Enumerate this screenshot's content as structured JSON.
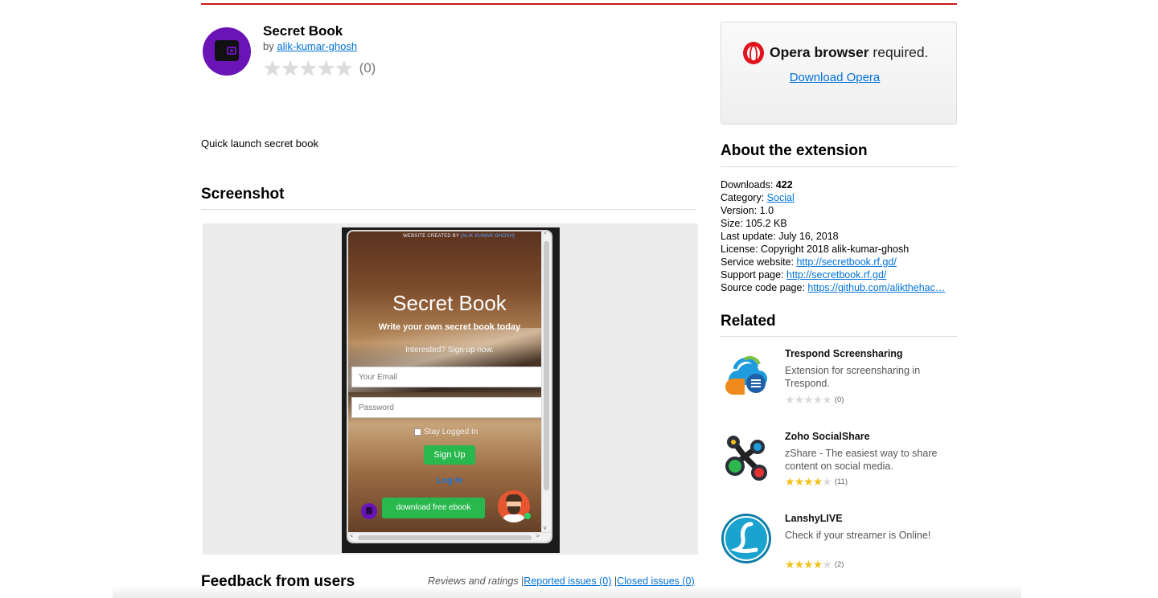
{
  "extension": {
    "title": "Secret Book",
    "by_label": "by",
    "author": "alik-kumar-ghosh",
    "rating_count": "(0)",
    "stars_filled": 0,
    "stars_total": 5,
    "summary": "Quick launch secret book",
    "icon": "wallet-icon"
  },
  "sections": {
    "screenshot": "Screenshot",
    "feedback": "Feedback from users",
    "about": "About the extension",
    "related": "Related"
  },
  "screenshot_popup": {
    "credit_prefix": "WEBSITE CREATED BY ",
    "credit_name": "[ALIK KUMAR GHOSH]",
    "title": "Secret Book",
    "subtitle": "Write your own secret book today",
    "interested": "Interested? Sign up now.",
    "email_placeholder": "Your Email",
    "password_placeholder": "Password",
    "stay_logged": "Stay Logged In",
    "signup": "Sign Up",
    "login": "Log In",
    "download": "download free ebook",
    "scroll_up": "^",
    "scroll_down": "v",
    "scroll_left": "<",
    "scroll_right": ">"
  },
  "feedback_links": {
    "reviews": "Reviews and ratings",
    "separator": "|",
    "reported": "Reported issues (0)",
    "closed": "Closed issues (0)"
  },
  "opera": {
    "brand": "Opera browser",
    "required": "required.",
    "download": "Download Opera",
    "logo": "opera-logo-icon"
  },
  "about": {
    "downloads_label": "Downloads: ",
    "downloads": "422",
    "category_label": "Category: ",
    "category": "Social",
    "version": "Version: 1.0",
    "size": "Size: 105.2 KB",
    "last_update": "Last update: July 16, 2018",
    "license": "License: Copyright 2018 alik-kumar-ghosh",
    "service_label": "Service website: ",
    "service_url": "http://secretbook.rf.gd/",
    "support_label": "Support page: ",
    "support_url": "http://secretbook.rf.gd/",
    "source_label": "Source code page: ",
    "source_url": "https://github.com/alikthehac…"
  },
  "related": [
    {
      "name": "Trespond Screensharing",
      "desc": "Extension for screensharing in Trespond.",
      "rating": 0,
      "count": "(0)",
      "icon": "cloud-screenshare-icon"
    },
    {
      "name": "Zoho SocialShare",
      "desc": "zShare - The easiest way to share content on social media.",
      "rating": 4,
      "count": "(11)",
      "icon": "share-nodes-icon"
    },
    {
      "name": "LanshyLIVE",
      "desc": "Check if your streamer is Online!",
      "rating": 4,
      "count": "(2)",
      "icon": "letter-l-icon"
    }
  ],
  "colors": {
    "accent_red": "#cc1b1b",
    "link": "#0072d9",
    "star_on": "#f3c21b",
    "star_off": "#dadada",
    "button_green": "#29b84d",
    "icon_purple": "#6a14b8"
  }
}
